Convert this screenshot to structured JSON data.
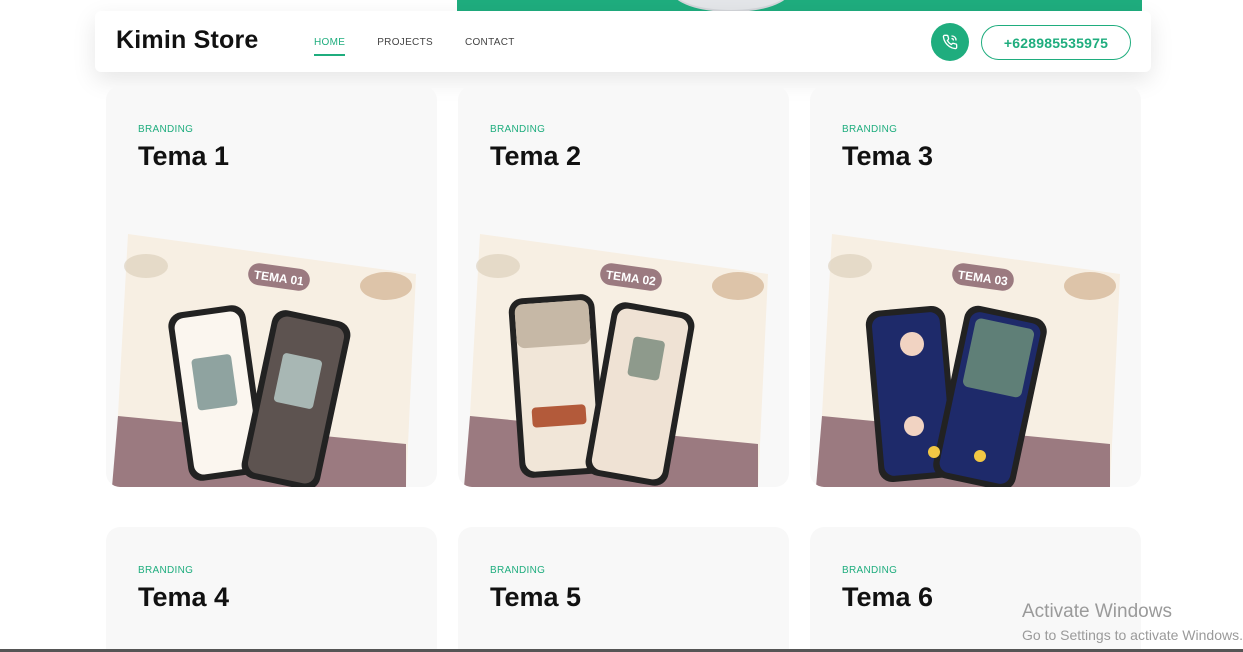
{
  "header": {
    "brand": "Kimin Store",
    "nav": [
      {
        "label": "HOME",
        "active": true
      },
      {
        "label": "PROJECTS",
        "active": false
      },
      {
        "label": "CONTACT",
        "active": false
      }
    ],
    "phone_icon": "phone-call-icon",
    "phone_number": "+628985535975"
  },
  "colors": {
    "accent": "#1fad7e",
    "card_bg": "#f8f8f8",
    "mauve": "#9b7a80",
    "cream": "#f7efe3"
  },
  "cards": [
    {
      "category": "BRANDING",
      "title": "Tema 1",
      "badge": "TEMA 01"
    },
    {
      "category": "BRANDING",
      "title": "Tema 2",
      "badge": "TEMA 02"
    },
    {
      "category": "BRANDING",
      "title": "Tema 3",
      "badge": "TEMA 03"
    },
    {
      "category": "BRANDING",
      "title": "Tema 4"
    },
    {
      "category": "BRANDING",
      "title": "Tema 5"
    },
    {
      "category": "BRANDING",
      "title": "Tema 6"
    }
  ],
  "watermark": {
    "line1": "Activate Windows",
    "line2": "Go to Settings to activate Windows."
  }
}
